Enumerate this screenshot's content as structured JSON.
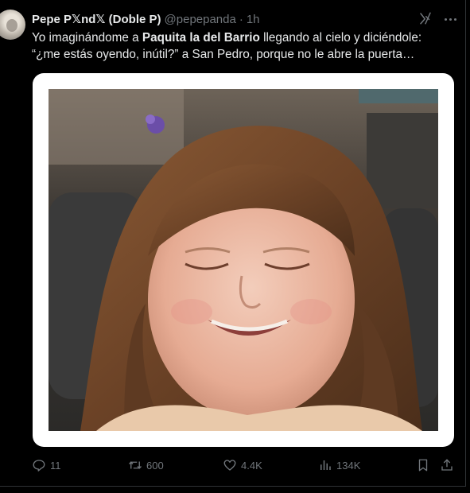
{
  "tweet": {
    "author": {
      "display_name": "Pepe P𝕏nd𝕏 (Doble P)",
      "handle": "@pepepanda",
      "separator": "·",
      "time": "1h"
    },
    "text": {
      "line1_prefix": "Yo imaginándome a ",
      "line1_bold": "Paquita la del Barrio",
      "line1_suffix": " llegando al cielo y diciéndole:",
      "line2": "“¿me estás oyendo, inútil?” a San Pedro, porque no le abre la puerta…"
    },
    "media": {
      "description_icon": "photo"
    },
    "actions": {
      "replies": "11",
      "reposts": "600",
      "likes": "4.4K",
      "views": "134K"
    }
  },
  "colors": {
    "background": "#000000",
    "text_primary": "#e7e9ea",
    "text_secondary": "#71767b",
    "media_border": "#ffffff"
  },
  "icons": {
    "grok": "grok-icon",
    "more": "more-icon",
    "reply": "reply-icon",
    "repost": "repost-icon",
    "like": "heart-icon",
    "views": "views-icon",
    "bookmark": "bookmark-icon",
    "share": "share-icon"
  }
}
